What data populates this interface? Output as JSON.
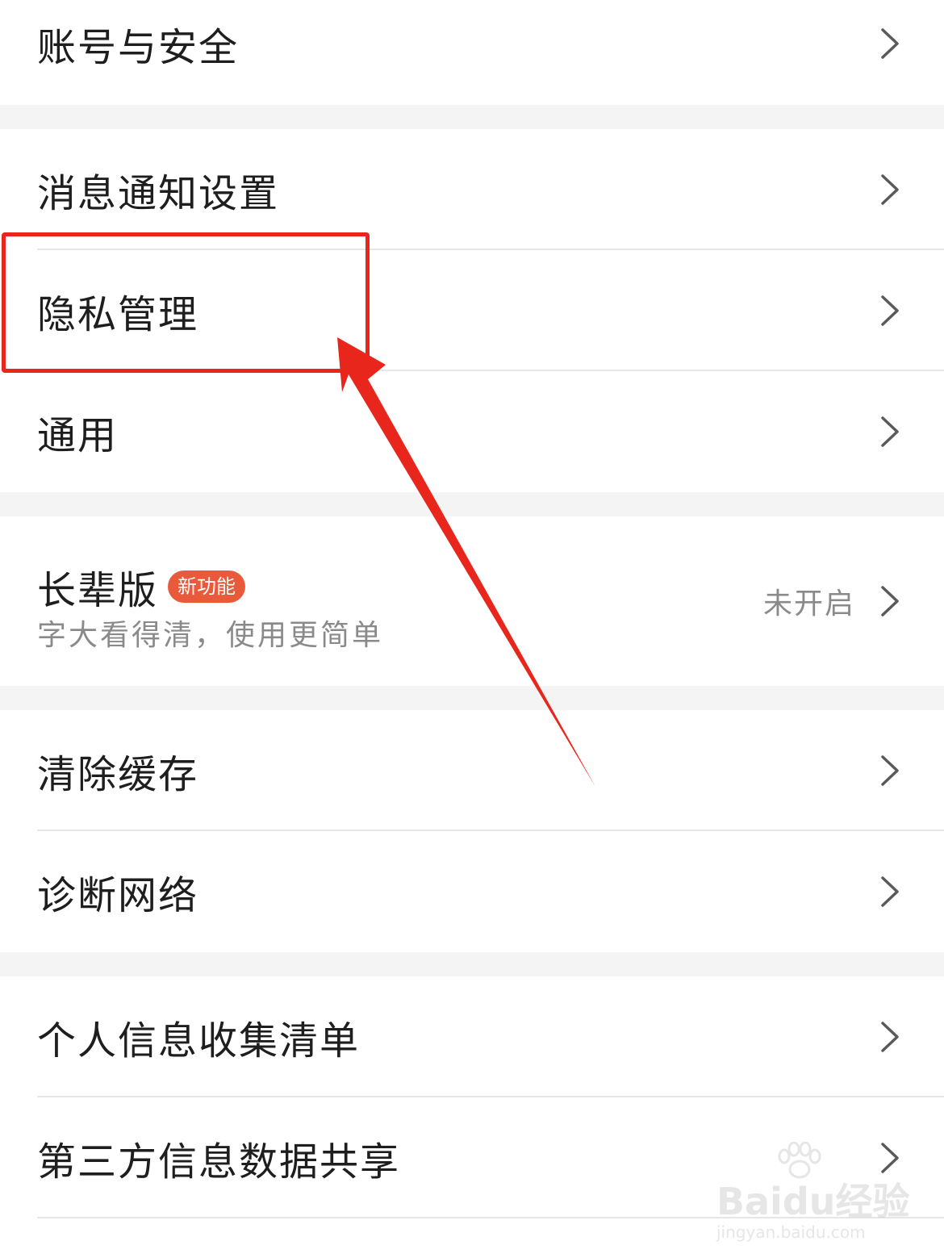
{
  "settings": {
    "account_security": "账号与安全",
    "notification_settings": "消息通知设置",
    "privacy_management": "隐私管理",
    "general": "通用",
    "elder_mode": {
      "title": "长辈版",
      "badge": "新功能",
      "subtitle": "字大看得清，使用更简单",
      "status": "未开启"
    },
    "clear_cache": "清除缓存",
    "diagnose_network": "诊断网络",
    "personal_info_list": "个人信息收集清单",
    "third_party_sharing": "第三方信息数据共享"
  },
  "annotation": {
    "highlight_color": "#e8261c"
  },
  "watermark": {
    "brand": "Baidu经验",
    "url": "jingyan.baidu.com"
  },
  "colors": {
    "background": "#ffffff",
    "section_gap": "#f4f4f4",
    "badge": "#e95a3b",
    "text_primary": "#1e1e1e",
    "text_secondary": "#8a8a8a"
  },
  "icons": {
    "row_chevron": "chevron-right-icon"
  }
}
